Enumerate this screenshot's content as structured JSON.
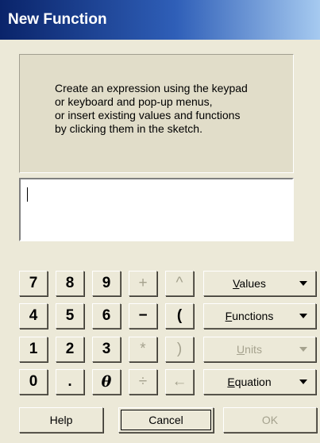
{
  "window": {
    "title": "New Function"
  },
  "instructions": {
    "lines": [
      "Create an expression using the keypad",
      "or keyboard and pop-up menus,",
      "or insert existing values and functions",
      "by clicking them in the sketch."
    ]
  },
  "expression": {
    "value": ""
  },
  "keypad": {
    "row1": [
      "7",
      "8",
      "9",
      "+",
      "^"
    ],
    "row2": [
      "4",
      "5",
      "6",
      "−",
      "("
    ],
    "row3": [
      "1",
      "2",
      "3",
      "*",
      ")"
    ],
    "row4": [
      "0",
      ".",
      "θ",
      "÷",
      "←"
    ]
  },
  "menus": {
    "values": "Values",
    "functions": "Functions",
    "units": "Units",
    "equation": "Equation"
  },
  "buttons": {
    "help": "Help",
    "cancel": "Cancel",
    "ok": "OK"
  }
}
